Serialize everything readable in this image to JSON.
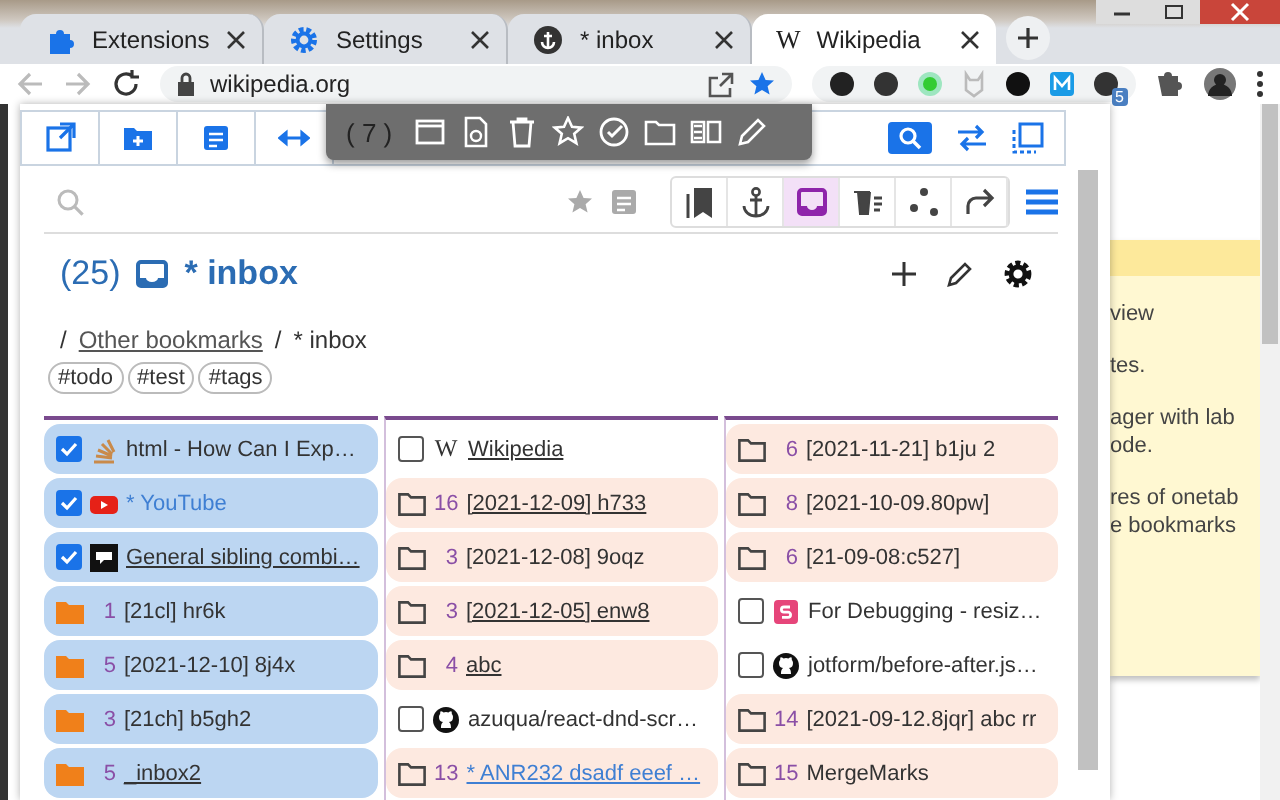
{
  "browser": {
    "tabs": [
      {
        "title": "Extensions",
        "selected": false
      },
      {
        "title": "Settings",
        "selected": false
      },
      {
        "title": "* inbox",
        "selected": false
      },
      {
        "title": "Wikipedia",
        "icon_text": "W",
        "selected": true
      }
    ],
    "address": "wikipedia.org",
    "bookmarked": true,
    "extension_badge": "5"
  },
  "popup": {
    "selection_bar": {
      "count": "( 7 )"
    },
    "views": [
      {
        "kind": "bookmarks",
        "selected": false
      },
      {
        "kind": "anchor",
        "selected": false
      },
      {
        "kind": "inbox",
        "selected": true
      },
      {
        "kind": "trash",
        "selected": false
      },
      {
        "kind": "dots",
        "selected": false
      },
      {
        "kind": "share",
        "selected": false
      }
    ],
    "folder": {
      "count": "(25)",
      "title": "* inbox"
    },
    "breadcrumb": [
      {
        "separator": "/",
        "text": "Other bookmarks",
        "link": true
      },
      {
        "separator": "/",
        "text": "* inbox",
        "link": false
      }
    ],
    "tags": [
      "#todo",
      "#test",
      "#tags"
    ],
    "columns": [
      [
        {
          "kind": "bookmark",
          "selected": true,
          "title": "html - How Can I Exp…",
          "underlined": false,
          "accent": false
        },
        {
          "kind": "bookmark",
          "selected": true,
          "title": "* YouTube",
          "underlined": false,
          "accent": true
        },
        {
          "kind": "bookmark",
          "selected": true,
          "title": "General sibling combi…",
          "underlined": true,
          "accent": false
        },
        {
          "kind": "folder",
          "selected": true,
          "count": "1",
          "title": "[21cl] hr6k",
          "underlined": false,
          "accent": false
        },
        {
          "kind": "folder",
          "selected": true,
          "count": "5",
          "title": "[2021-12-10] 8j4x",
          "underlined": false,
          "accent": false
        },
        {
          "kind": "folder",
          "selected": true,
          "count": "3",
          "title": "[21ch] b5gh2",
          "underlined": false,
          "accent": false
        },
        {
          "kind": "folder",
          "selected": true,
          "count": "5",
          "title": "_inbox2",
          "underlined": true,
          "accent": false
        }
      ],
      [
        {
          "kind": "bookmark",
          "selected": false,
          "favicon_text": "W",
          "title": "Wikipedia",
          "underlined": true,
          "accent": false
        },
        {
          "kind": "folder",
          "selected": false,
          "count": "16",
          "title": "[2021-12-09] h733",
          "underlined": true,
          "accent": false
        },
        {
          "kind": "folder",
          "selected": false,
          "count": "3",
          "title": "[2021-12-08] 9oqz",
          "underlined": false,
          "accent": false
        },
        {
          "kind": "folder",
          "selected": false,
          "count": "3",
          "title": "[2021-12-05] enw8",
          "underlined": true,
          "accent": false
        },
        {
          "kind": "folder",
          "selected": false,
          "count": "4",
          "title": "abc",
          "underlined": true,
          "accent": false
        },
        {
          "kind": "bookmark",
          "selected": false,
          "title": "azuqua/react-dnd-scr…",
          "underlined": false,
          "accent": false
        },
        {
          "kind": "folder",
          "selected": false,
          "count": "13",
          "title": "* ANR232 dsadf eeef …",
          "underlined": true,
          "accent": true
        }
      ],
      [
        {
          "kind": "folder",
          "selected": false,
          "count": "6",
          "title": "[2021-11-21] b1ju 2",
          "underlined": false,
          "accent": false
        },
        {
          "kind": "folder",
          "selected": false,
          "count": "8",
          "title": "[2021-10-09.80pw]",
          "underlined": false,
          "accent": false
        },
        {
          "kind": "folder",
          "selected": false,
          "count": "6",
          "title": "[21-09-08:c527]",
          "underlined": false,
          "accent": false
        },
        {
          "kind": "bookmark",
          "selected": false,
          "title": "For Debugging - resiz…",
          "underlined": false,
          "accent": false
        },
        {
          "kind": "bookmark",
          "selected": false,
          "title": "jotform/before-after.js…",
          "underlined": false,
          "accent": false
        },
        {
          "kind": "folder",
          "selected": false,
          "count": "14",
          "title": "[2021-09-12.8jqr] abc rr",
          "underlined": false,
          "accent": false
        },
        {
          "kind": "folder",
          "selected": false,
          "count": "15",
          "title": "MergeMarks",
          "underlined": false,
          "accent": false
        }
      ]
    ]
  },
  "note": {
    "lines": [
      "view",
      "tes.",
      "ager with lab",
      "ode.",
      "res of onetab",
      "e bookmarks"
    ]
  }
}
